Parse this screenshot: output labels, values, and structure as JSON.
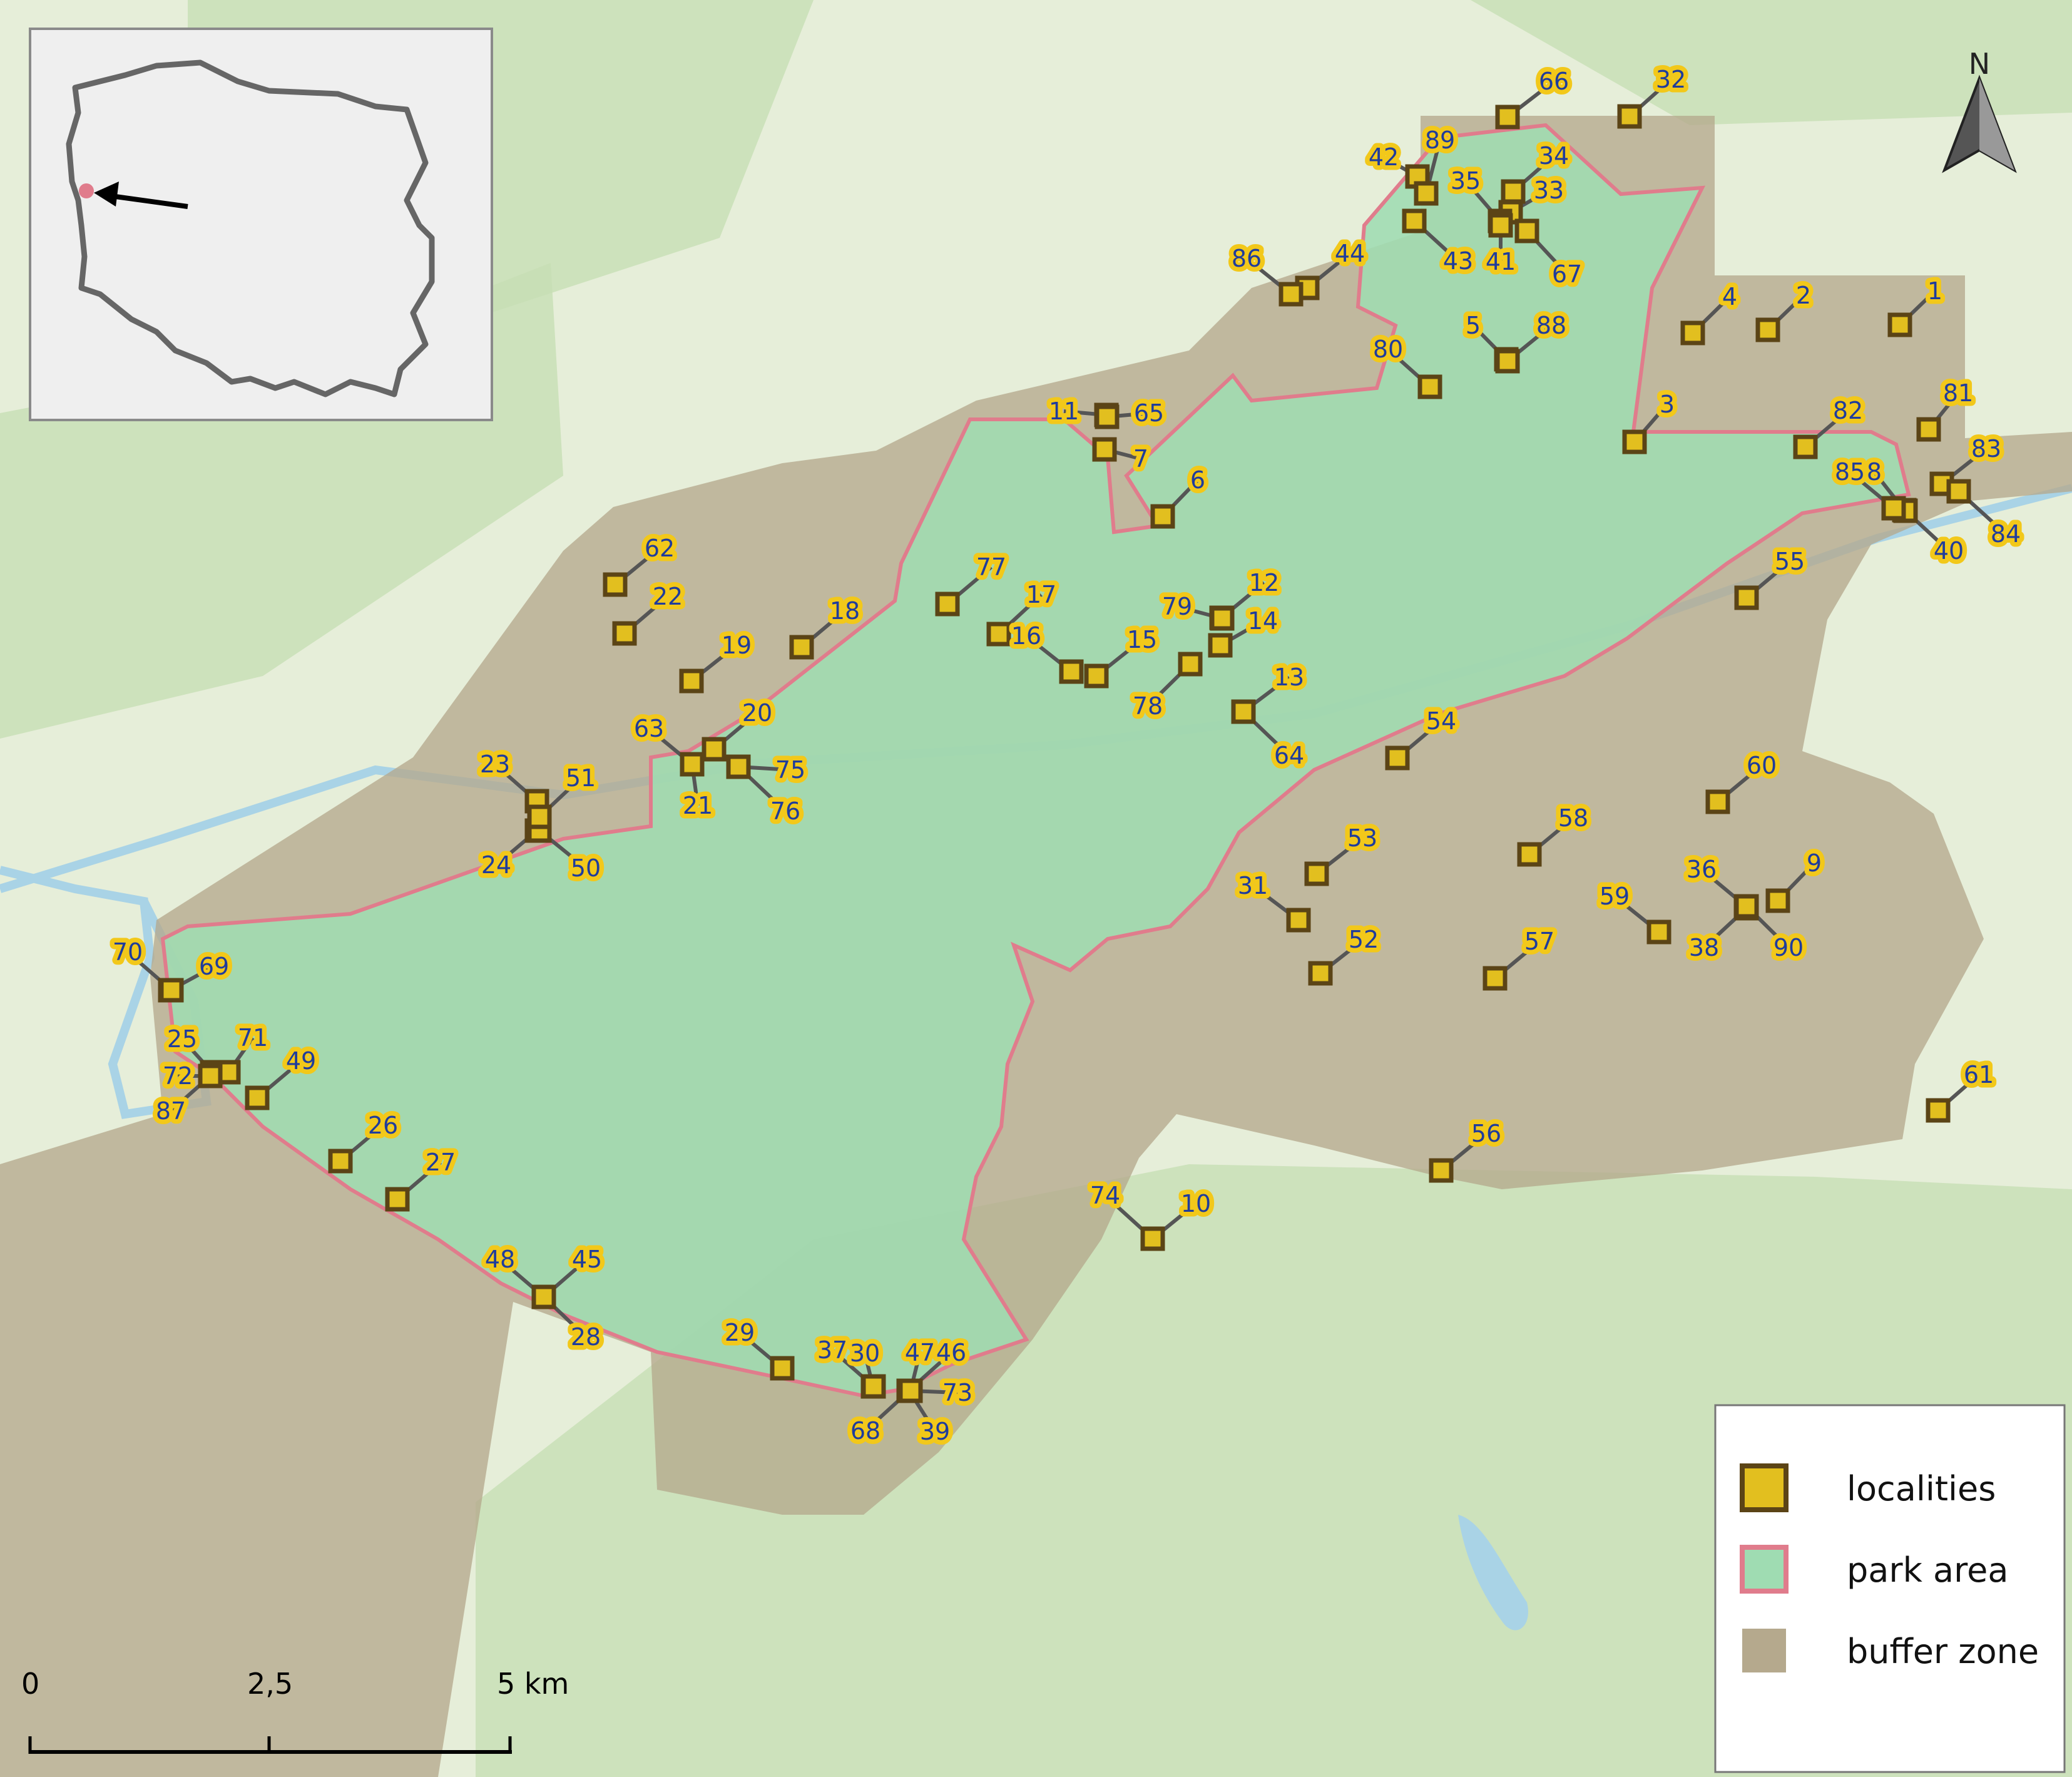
{
  "colors": {
    "background": "#e6eed9",
    "forest": "#c7dfb4",
    "park_fill": "#9fdcb2",
    "park_border": "#e07c8c",
    "buffer_fill": "#b5a98d",
    "locality_fill": "#e2bf1f",
    "locality_border": "#5b4416",
    "leader": "#555555",
    "label_text": "#1f3c9c",
    "label_halo": "#f2c81a",
    "water": "#a9d3e6"
  },
  "inset": {
    "marker": "site-marker",
    "arrow": "arrow-icon"
  },
  "north_arrow": {
    "label": "N"
  },
  "scale_bar": {
    "labels": [
      "0",
      "2,5",
      "5 km"
    ]
  },
  "legend": {
    "items": [
      {
        "label": "localities",
        "symbol": "locality"
      },
      {
        "label": "park area",
        "symbol": "park"
      },
      {
        "label": "buffer zone",
        "symbol": "buffer"
      }
    ]
  },
  "localities": [
    {
      "id": "1"
    },
    {
      "id": "2"
    },
    {
      "id": "3"
    },
    {
      "id": "4"
    },
    {
      "id": "5"
    },
    {
      "id": "6"
    },
    {
      "id": "7"
    },
    {
      "id": "8"
    },
    {
      "id": "9"
    },
    {
      "id": "10"
    },
    {
      "id": "11"
    },
    {
      "id": "12"
    },
    {
      "id": "13"
    },
    {
      "id": "14"
    },
    {
      "id": "15"
    },
    {
      "id": "16"
    },
    {
      "id": "17"
    },
    {
      "id": "18"
    },
    {
      "id": "19"
    },
    {
      "id": "20"
    },
    {
      "id": "21"
    },
    {
      "id": "22"
    },
    {
      "id": "23"
    },
    {
      "id": "24"
    },
    {
      "id": "25"
    },
    {
      "id": "26"
    },
    {
      "id": "27"
    },
    {
      "id": "28"
    },
    {
      "id": "29"
    },
    {
      "id": "30"
    },
    {
      "id": "31"
    },
    {
      "id": "32"
    },
    {
      "id": "33"
    },
    {
      "id": "34"
    },
    {
      "id": "35"
    },
    {
      "id": "36"
    },
    {
      "id": "37"
    },
    {
      "id": "38"
    },
    {
      "id": "39"
    },
    {
      "id": "40"
    },
    {
      "id": "41"
    },
    {
      "id": "42"
    },
    {
      "id": "43"
    },
    {
      "id": "44"
    },
    {
      "id": "45"
    },
    {
      "id": "46"
    },
    {
      "id": "47"
    },
    {
      "id": "48"
    },
    {
      "id": "49"
    },
    {
      "id": "50"
    },
    {
      "id": "51"
    },
    {
      "id": "52"
    },
    {
      "id": "53"
    },
    {
      "id": "54"
    },
    {
      "id": "55"
    },
    {
      "id": "56"
    },
    {
      "id": "57"
    },
    {
      "id": "58"
    },
    {
      "id": "59"
    },
    {
      "id": "60"
    },
    {
      "id": "61"
    },
    {
      "id": "62"
    },
    {
      "id": "63"
    },
    {
      "id": "64"
    },
    {
      "id": "65"
    },
    {
      "id": "66"
    },
    {
      "id": "67"
    },
    {
      "id": "68"
    },
    {
      "id": "69"
    },
    {
      "id": "70"
    },
    {
      "id": "71"
    },
    {
      "id": "72"
    },
    {
      "id": "73"
    },
    {
      "id": "74"
    },
    {
      "id": "75"
    },
    {
      "id": "76"
    },
    {
      "id": "77"
    },
    {
      "id": "78"
    },
    {
      "id": "79"
    },
    {
      "id": "80"
    },
    {
      "id": "81"
    },
    {
      "id": "82"
    },
    {
      "id": "83"
    },
    {
      "id": "84"
    },
    {
      "id": "85"
    },
    {
      "id": "86"
    },
    {
      "id": "87"
    },
    {
      "id": "88"
    },
    {
      "id": "89"
    },
    {
      "id": "90"
    }
  ]
}
